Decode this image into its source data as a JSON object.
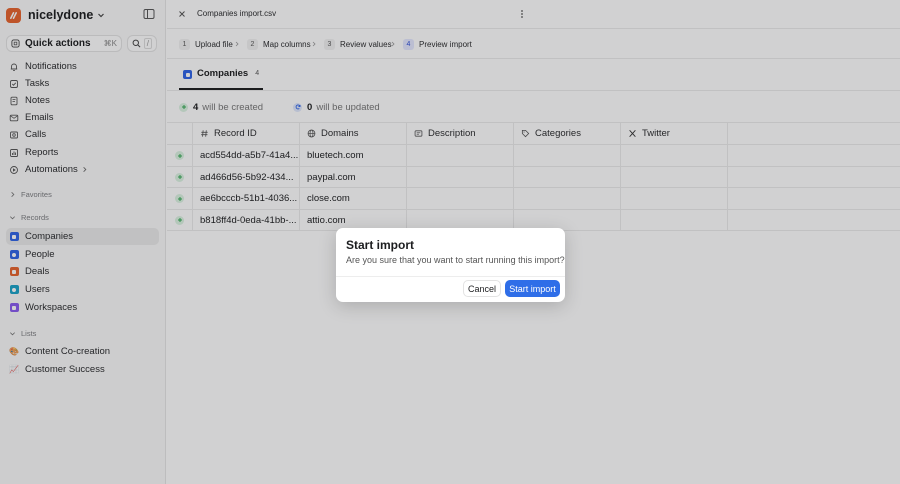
{
  "workspace": {
    "name": "nicelydone"
  },
  "quick_actions": {
    "label": "Quick actions",
    "shortcut": "⌘K",
    "search_shortcut": "/"
  },
  "nav": {
    "notifications": "Notifications",
    "tasks": "Tasks",
    "notes": "Notes",
    "emails": "Emails",
    "calls": "Calls",
    "reports": "Reports",
    "automations": "Automations"
  },
  "sections": {
    "favorites": "Favorites",
    "records": "Records",
    "lists": "Lists"
  },
  "records": [
    {
      "label": "Companies",
      "color": "#2f64e8",
      "active": true
    },
    {
      "label": "People",
      "color": "#2f64e8",
      "active": false
    },
    {
      "label": "Deals",
      "color": "#e8632c",
      "active": false
    },
    {
      "label": "Users",
      "color": "#1aa3c8",
      "active": false
    },
    {
      "label": "Workspaces",
      "color": "#8a5cf0",
      "active": false
    }
  ],
  "lists": [
    {
      "label": "Content Co-creation",
      "emoji": "🎨"
    },
    {
      "label": "Customer Success",
      "emoji": "📈"
    }
  ],
  "header": {
    "file_title": "Companies import.csv"
  },
  "steps": [
    {
      "num": "1",
      "label": "Upload file"
    },
    {
      "num": "2",
      "label": "Map columns"
    },
    {
      "num": "3",
      "label": "Review values"
    },
    {
      "num": "4",
      "label": "Preview import"
    }
  ],
  "tab": {
    "label": "Companies",
    "count": "4"
  },
  "summary": {
    "created_count": "4",
    "created_label": "will be created",
    "updated_count": "0",
    "updated_label": "will be updated"
  },
  "table": {
    "columns": [
      "Record ID",
      "Domains",
      "Description",
      "Categories",
      "Twitter"
    ],
    "rows": [
      {
        "record_id": "acd554dd-a5b7-41a4...",
        "domain": "bluetech.com"
      },
      {
        "record_id": "ad466d56-5b92-434...",
        "domain": "paypal.com"
      },
      {
        "record_id": "ae6bcccb-51b1-4036...",
        "domain": "close.com"
      },
      {
        "record_id": "b818ff4d-0eda-41bb-...",
        "domain": "attio.com"
      }
    ]
  },
  "dialog": {
    "title": "Start import",
    "message": "Are you sure that you want to start running this import?",
    "cancel_label": "Cancel",
    "confirm_label": "Start import"
  },
  "colors": {
    "accent": "#2f6ee8",
    "brand": "#e8632c",
    "create": "#32a852"
  }
}
